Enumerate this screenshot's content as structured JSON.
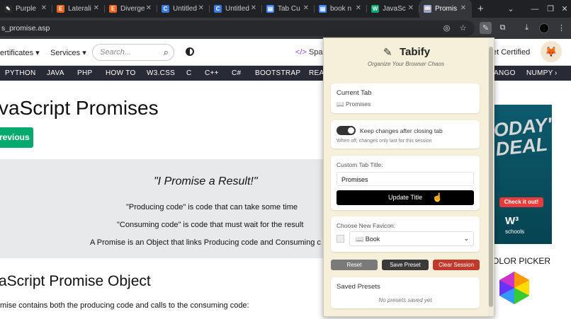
{
  "tabs": [
    {
      "label": "Purple",
      "favicon": "pen-icon",
      "color": "#2b2b2b",
      "glyph": "✎"
    },
    {
      "label": "Laterali",
      "favicon": "etsy-icon",
      "color": "#f1641e",
      "glyph": "E"
    },
    {
      "label": "Diverge",
      "favicon": "etsy-icon",
      "color": "#f1641e",
      "glyph": "E"
    },
    {
      "label": "Untitled",
      "favicon": "chatgpt-icon",
      "color": "#3b7be0",
      "glyph": "C"
    },
    {
      "label": "Untitled",
      "favicon": "chatgpt-icon",
      "color": "#3b7be0",
      "glyph": "C"
    },
    {
      "label": "Tab Cu",
      "favicon": "doc-icon",
      "color": "#4285f4",
      "glyph": "▤"
    },
    {
      "label": "book n",
      "favicon": "doc-icon",
      "color": "#4285f4",
      "glyph": "▤"
    },
    {
      "label": "JavaSc",
      "favicon": "w3-icon",
      "color": "#04aa6d",
      "glyph": "W"
    },
    {
      "label": "Promis",
      "favicon": "book-icon",
      "color": "#9ab0d8",
      "glyph": "📖",
      "active": true
    }
  ],
  "address": {
    "url": "s_promise.asp"
  },
  "site": {
    "nav_certificates": "ertificates ▾",
    "nav_services": "Services ▾",
    "search_placeholder": "Search...",
    "spaces": "Spac",
    "get_certified": "et Certified",
    "langs": [
      "PYTHON",
      "JAVA",
      "PHP",
      "HOW TO",
      "W3.CSS",
      "C",
      "C++",
      "C#",
      "BOOTSTRAP",
      "REAC",
      "ANGO",
      "NUMPY"
    ],
    "h1": "vaScript Promises",
    "previous": "revious",
    "quote_title": "\"I Promise a Result!\"",
    "quote_line1": "\"Producing code\" is code that can take some time",
    "quote_line2": "\"Consuming code\" is code that must wait for the result",
    "quote_line3": "A Promise is an Object that links Producing code and Consuming c",
    "h2": "aScript Promise Object",
    "paragraph": "mise contains both the producing code and calls to the consuming code:",
    "ad_title": "ODAY'S DEAL",
    "ad_cta": "Check it out!",
    "ad_brand": "W³",
    "ad_brand_sub": "schools",
    "color_picker": "OLOR PICKER"
  },
  "tabify": {
    "title": "Tabify",
    "subtitle": "Organize Your Browser Chaos",
    "current_tab_heading": "Current Tab",
    "current_tab_name": "Promises",
    "toggle_label": "Keep changes after closing tab",
    "toggle_hint": "When off, changes only last for this session",
    "custom_title_label": "Custom Tab Title:",
    "custom_title_value": "Promises",
    "update_button": "Update Title",
    "favicon_label": "Choose New Favicon:",
    "favicon_selected": "Book",
    "reset_button": "Reset",
    "save_preset_button": "Save Preset",
    "clear_session_button": "Clear Session",
    "saved_presets_heading": "Saved Presets",
    "no_presets": "No presets saved yet"
  },
  "colors": {
    "reset": "#7a7a7a",
    "save_preset": "#3a3a3a",
    "clear_session": "#c0392b",
    "accent_green": "#04aa6d"
  }
}
